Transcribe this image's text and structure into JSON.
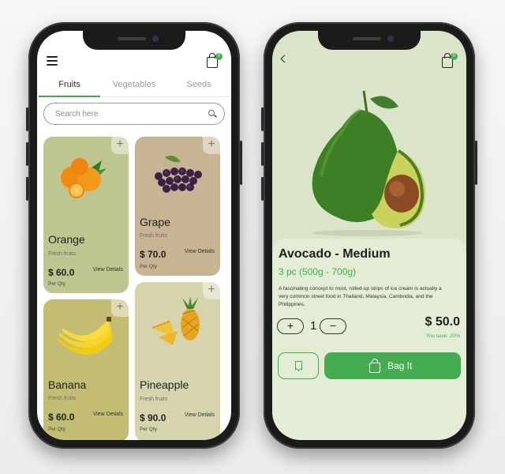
{
  "catalog": {
    "cart_badge": "0",
    "tabs": [
      {
        "label": "Fruits",
        "active": true
      },
      {
        "label": "Vegetables",
        "active": false
      },
      {
        "label": "Seeds",
        "active": false
      }
    ],
    "search": {
      "placeholder": "Search here"
    },
    "products": [
      {
        "name": "Orange",
        "category": "Fresh fruits",
        "price": "$ 60.0",
        "unit": "Per Qty",
        "action": "View Detials",
        "color": "#bfc58f"
      },
      {
        "name": "Grape",
        "category": "Fresh fruits",
        "price": "$ 70.0",
        "unit": "Per Qty",
        "action": "View Detials",
        "color": "#c7b493"
      },
      {
        "name": "Banana",
        "category": "Fresh fruits",
        "price": "$ 60.0",
        "unit": "Per Qty",
        "action": "View Detials",
        "color": "#c3bd73"
      },
      {
        "name": "Pineapple",
        "category": "Fresh fruits",
        "price": "$ 90.0",
        "unit": "Per Qty",
        "action": "View Detials",
        "color": "#d6d4ad"
      }
    ]
  },
  "detail": {
    "cart_badge": "0",
    "title": "Avocado - Medium",
    "weight": "3 pc (500g - 700g)",
    "description": "A fascinating concept to most, rolled-up strips of ice cream is actually a very common street food in Thailand, Malaysia, Cambodia, and the Philippines.",
    "quantity": "1",
    "plus_label": "+",
    "minus_label": "−",
    "total": "$ 50.0",
    "savings": "You save: 20%",
    "bag_button": "Bag It",
    "accent": "#3fae4f"
  }
}
